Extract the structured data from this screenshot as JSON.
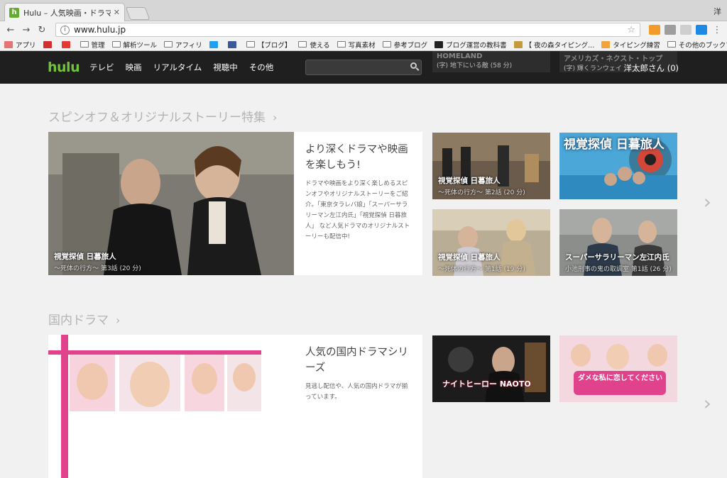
{
  "browser": {
    "tab_title": "Hulu – 人気映画・ドラマ・アニ",
    "tab_favicon": "h",
    "window_user": "洋",
    "url": "www.hulu.jp"
  },
  "bookmarks": [
    {
      "label": "アプリ",
      "icon": "apps-icon",
      "color": "#e57373"
    },
    {
      "label": "",
      "icon": "gmail-icon",
      "color": "#d32f2f"
    },
    {
      "label": "",
      "icon": "circle-icon",
      "color": "#e53935"
    },
    {
      "label": "管理",
      "icon": "folder-icon"
    },
    {
      "label": "解析ツール",
      "icon": "folder-icon"
    },
    {
      "label": "アフィリ",
      "icon": "folder-icon"
    },
    {
      "label": "",
      "icon": "twitter-icon",
      "color": "#1da1f2"
    },
    {
      "label": "",
      "icon": "facebook-icon",
      "color": "#3b5998"
    },
    {
      "label": "【ブログ】",
      "icon": "folder-icon"
    },
    {
      "label": "使える",
      "icon": "folder-icon"
    },
    {
      "label": "写真素材",
      "icon": "folder-icon"
    },
    {
      "label": "参考ブログ",
      "icon": "folder-icon"
    },
    {
      "label": "ブログ運営の教科書",
      "icon": "site-icon",
      "color": "#222"
    },
    {
      "label": "【 夜の森タイピング...",
      "icon": "site-icon",
      "color": "#c49a3a"
    },
    {
      "label": "タイピング練習",
      "icon": "site-icon",
      "color": "#f2a33a"
    },
    {
      "label": "その他のブックマーク",
      "icon": "folder-icon"
    }
  ],
  "header": {
    "logo": "hulu",
    "nav": [
      "テレビ",
      "映画",
      "リアルタイム",
      "視聴中",
      "その他"
    ],
    "search_placeholder": "",
    "user": "洋太郎さん (0)",
    "peek_left": "HOMELAND",
    "peek_left_sub": "(字) 地下にいる敵 (58 分)",
    "peek_right": "アメリカズ・ネクスト・トップ",
    "peek_right_sub": "(字) 輝くランウェイ"
  },
  "sections": [
    {
      "title": "スピンオフ＆オリジナルストーリー特集",
      "feature": {
        "caption_title": "視覚探偵 日暮旅人",
        "caption_sub": "〜死体の行方〜 第3話 (20 分)",
        "heading": "より深くドラマや映画を楽しもう!",
        "body": "ドラマや映画をより深く楽しめるスピンオフやオリジナルストーリーをご紹介。「東京タラレバ娘」「スーパーサラリーマン左江内氏」「視覚探偵 日暮旅人」 など人気ドラマのオリジナルストーリーも配信中!"
      },
      "tiles": [
        {
          "title": "視覚探偵 日暮旅人",
          "sub": "〜死体の行方〜 第2話 (20 分)"
        },
        {
          "title": "視覚探偵 日暮旅人",
          "sub": ""
        },
        {
          "title": "視覚探偵 日暮旅人",
          "sub": "〜死体の行方〜 第1話 (19 分)"
        },
        {
          "title": "スーパーサラリーマン左江内氏",
          "sub": "小池刑事の鬼の取調室 第1話 (26 分)"
        }
      ]
    },
    {
      "title": "国内ドラマ",
      "feature": {
        "heading": "人気の国内ドラマシリーズ",
        "body": "見逃し配信や、人気の国内ドラマが揃っています。"
      },
      "tiles": [
        {
          "title": "ナイトヒーロー NAOTO",
          "sub": ""
        },
        {
          "title": "ダメな私に恋してください",
          "sub": ""
        }
      ]
    }
  ],
  "colors": {
    "brand_green": "#71c33a",
    "header_bg": "#1f1f1f",
    "page_bg": "#f1f1f1"
  }
}
